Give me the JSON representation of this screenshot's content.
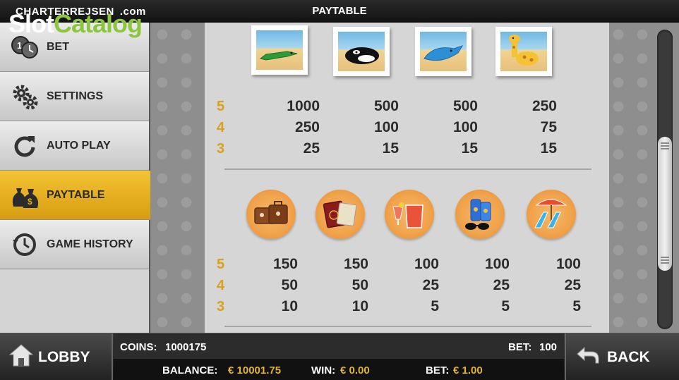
{
  "topbar": {
    "brand_name": "CHARTERREJSEN",
    "brand_domain": ".com",
    "title": "PAYTABLE"
  },
  "watermark": {
    "part1": "Slot",
    "part2": "Catalog"
  },
  "sidebar": {
    "items": [
      {
        "label": "BET",
        "icon": "coins-icon"
      },
      {
        "label": "SETTINGS",
        "icon": "gears-icon"
      },
      {
        "label": "AUTO PLAY",
        "icon": "refresh-icon"
      },
      {
        "label": "PAYTABLE",
        "icon": "money-bags-icon",
        "active": true
      },
      {
        "label": "GAME HISTORY",
        "icon": "history-clock-icon"
      }
    ]
  },
  "paytable": {
    "count_labels": [
      "5",
      "4",
      "3"
    ],
    "high_symbols": [
      {
        "icon": "crocodile-photo-icon",
        "pays": [
          "1000",
          "250",
          "25"
        ]
      },
      {
        "icon": "orca-photo-icon",
        "pays": [
          "500",
          "100",
          "15"
        ]
      },
      {
        "icon": "dolphin-photo-icon",
        "pays": [
          "500",
          "100",
          "15"
        ]
      },
      {
        "icon": "giraffe-photo-icon",
        "pays": [
          "250",
          "75",
          "15"
        ]
      }
    ],
    "low_symbols": [
      {
        "icon": "suitcases-icon",
        "pays": [
          "150",
          "50",
          "10"
        ]
      },
      {
        "icon": "passports-icon",
        "pays": [
          "150",
          "50",
          "10"
        ]
      },
      {
        "icon": "juice-pitcher-icon",
        "pays": [
          "100",
          "25",
          "5"
        ]
      },
      {
        "icon": "sunscreen-icon",
        "pays": [
          "100",
          "25",
          "5"
        ]
      },
      {
        "icon": "beach-chairs-icon",
        "pays": [
          "100",
          "25",
          "5"
        ]
      }
    ]
  },
  "bottombar": {
    "lobby_label": "LOBBY",
    "back_label": "BACK",
    "coins_label": "COINS:",
    "coins_value": "1000175",
    "bet_label": "BET:",
    "bet_value": "100",
    "balance_label": "BALANCE:",
    "balance_value": "€ 10001.75",
    "win_label": "WIN:",
    "win_value": "€ 0.00",
    "bet2_label": "BET:",
    "bet2_value": "€ 1.00"
  },
  "colors": {
    "accent_gold": "#e3b431",
    "active_menu": "#e2ab1d",
    "watermark_green": "#8cc63f"
  }
}
